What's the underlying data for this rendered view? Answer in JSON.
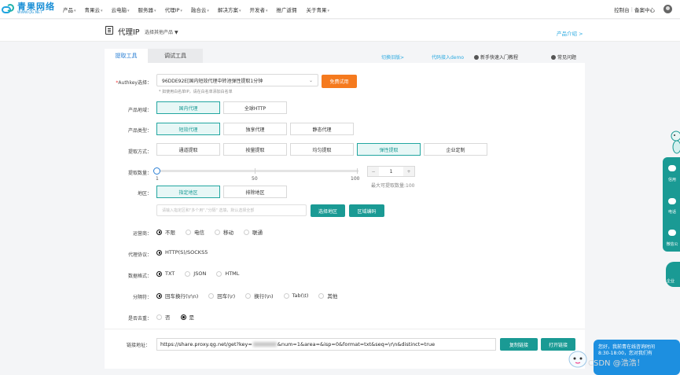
{
  "logo": {
    "name": "青果网络",
    "url": "WWW.QG.NET"
  },
  "nav": {
    "items": [
      {
        "label": "产品",
        "caret": "▾"
      },
      {
        "label": "青果云",
        "caret": "▾"
      },
      {
        "label": "云电脑",
        "caret": "▾"
      },
      {
        "label": "服务器",
        "caret": "▾"
      },
      {
        "label": "代理IP",
        "caret": "▾"
      },
      {
        "label": "融合云",
        "caret": "▾"
      },
      {
        "label": "解决方案",
        "caret": "▾"
      },
      {
        "label": "开发者",
        "caret": "▾"
      },
      {
        "label": "推广返佣",
        "caret": ""
      },
      {
        "label": "关于青果",
        "caret": "▾"
      }
    ],
    "console": "控制台",
    "separator": "|",
    "message_center": "备案中心"
  },
  "subheader": {
    "title": "代理IP",
    "select_label": "选择其他产品",
    "caret": "▼",
    "intro_link": "产品介绍 >"
  },
  "tabs": {
    "extract": "提取工具",
    "debug": "调试工具",
    "switch_old": "切换旧版>",
    "code_demo": "代码接入demo",
    "quick_start": "新手快速入门教程",
    "faq": "常见问题"
  },
  "form": {
    "authkey_label_star": "*",
    "authkey_label": "Authkey选择：",
    "authkey_value": "96DDE92E[国内短效代理中转池弹性提取1分钟",
    "free_trial": "免费试用",
    "whitelist_hint": "* 如使用白名单IP，请在白名单添加白名单",
    "region_label": "产品地域：",
    "region_options": [
      "国内代理",
      "全球HTTP"
    ],
    "type_label": "产品类型：",
    "type_options": [
      "短效代理",
      "独享代理",
      "静态代理"
    ],
    "method_label": "提取方式：",
    "method_options": [
      "通道提取",
      "按量提取",
      "均匀提取",
      "弹性提取",
      "企业定制"
    ],
    "count_label": "提取数量：",
    "slider_ticks": [
      "1",
      "50",
      "100"
    ],
    "slider_value_fraction": 0,
    "stepper_minus": "−",
    "stepper_value": "1",
    "stepper_plus": "+",
    "max_count": "最大可提取数量:100",
    "area_label": "地区：",
    "area_options": [
      "指定地区",
      "排除地区"
    ],
    "area_placeholder": "请输入指定区和\"多个用\",\"分隔\" 选填，默认选择全部",
    "select_area": "选择地区",
    "area_code": "区域编码",
    "isp_label": "运营商：",
    "isp_options": [
      "不限",
      "电信",
      "移动",
      "联通"
    ],
    "protocol_label": "代理协议：",
    "protocol_options": [
      "HTTP(S)/SOCKS5"
    ],
    "format_label": "数据格式：",
    "format_options": [
      "TXT",
      "JSON",
      "HTML"
    ],
    "separator_label": "分隔符：",
    "separator_options": [
      "回车换行(\\r\\n)",
      "回车(\\r)",
      "换行(\\n)",
      "Tab(\\t)",
      "其他"
    ],
    "distinct_label": "是否去重：",
    "distinct_options": [
      "否",
      "是"
    ],
    "link_label": "链接地址：",
    "link_prefix": "https://share.proxy.qg.net/get?key=",
    "link_suffix": "&num=1&area=&isp=0&format=txt&seq=\\r\\n&distinct=true",
    "copy_link": "复制链接",
    "open_link": "打开链接"
  },
  "side": {
    "items": [
      "信用",
      "电话",
      "微信公"
    ],
    "bottom": "企业"
  },
  "chat": {
    "line1": "您好，我前青在线咨询时间",
    "line2": "8:30-18:00，您对我们有"
  },
  "watermark": "CSDN @浩浩！"
}
